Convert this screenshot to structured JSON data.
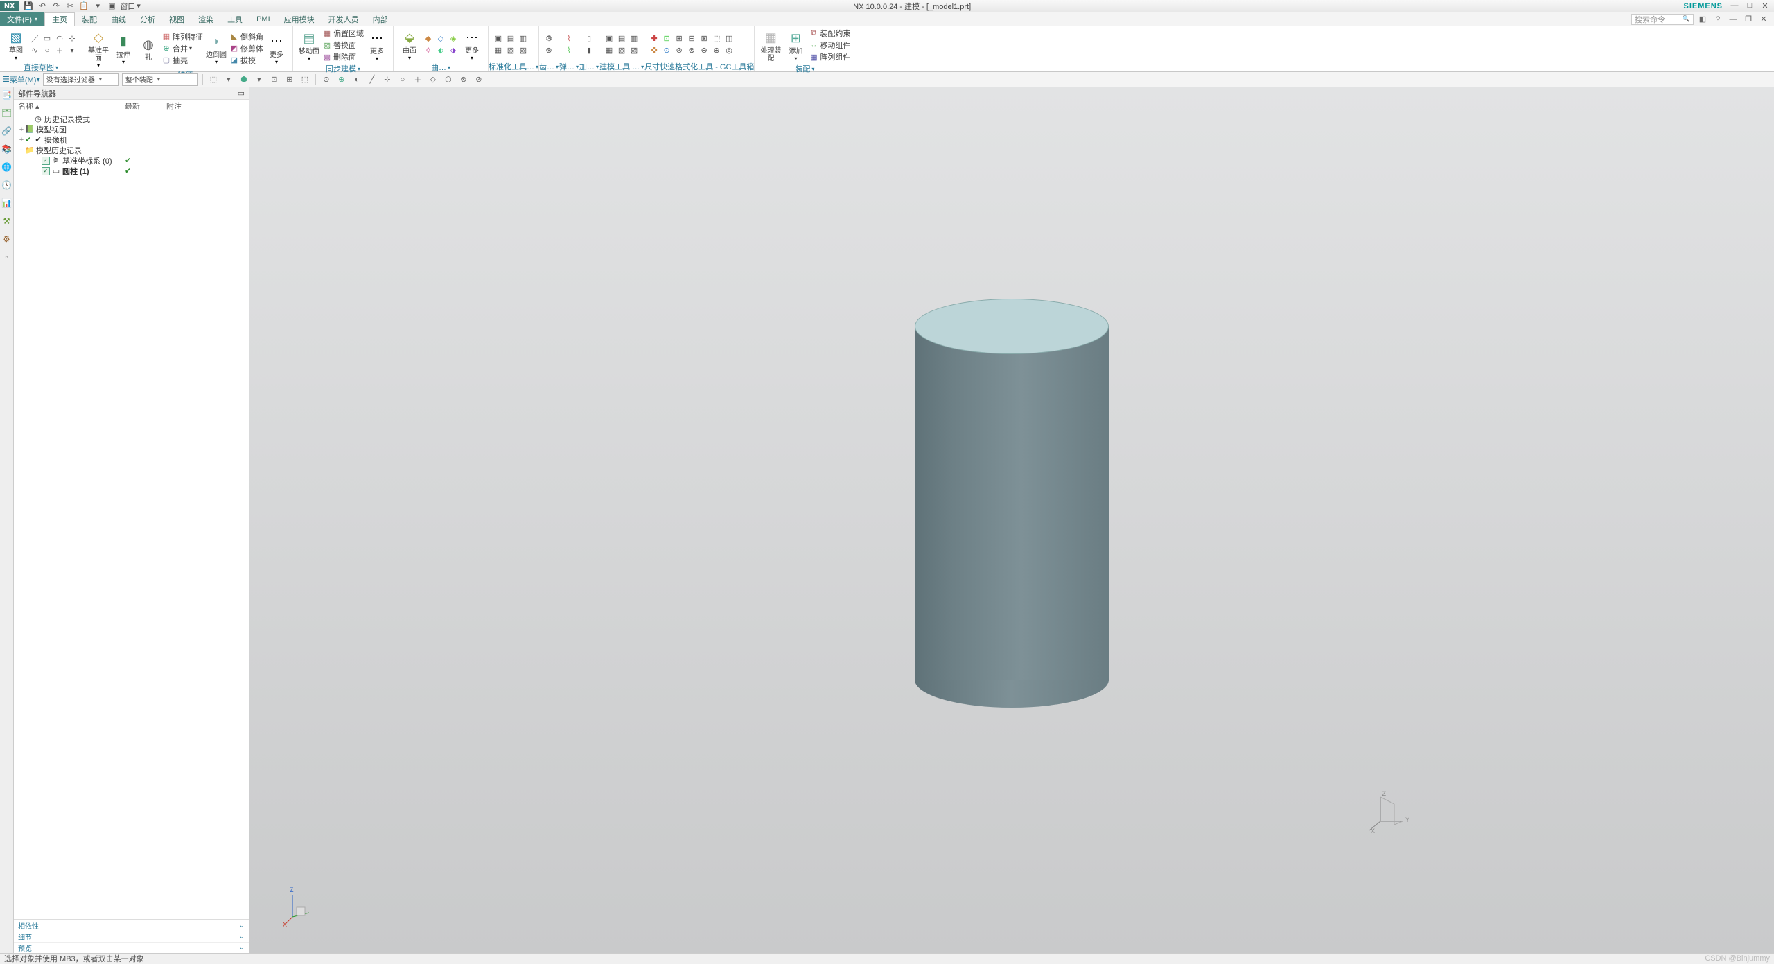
{
  "app": {
    "logo": "NX",
    "title": "NX 10.0.0.24 - 建模 - [_model1.prt]",
    "brand": "SIEMENS"
  },
  "qat": {
    "window_menu": "窗口"
  },
  "tabs": {
    "file": "文件(F)",
    "items": [
      "主页",
      "装配",
      "曲线",
      "分析",
      "视图",
      "渲染",
      "工具",
      "PMI",
      "应用模块",
      "开发人员",
      "内部"
    ],
    "active": 0
  },
  "search_placeholder": "搜索命令",
  "ribbon": {
    "g1": {
      "label": "直接草图",
      "sketch": "草图"
    },
    "g2": {
      "label": "特征",
      "datum": "基准平面",
      "extrude": "拉伸",
      "hole": "孔",
      "pattern": "阵列特征",
      "unite": "合并",
      "shell": "抽壳",
      "chamfer": "边倒圆",
      "draft": "倒斜角",
      "trim": "修剪体",
      "mold": "拔模",
      "more": "更多"
    },
    "g3": {
      "label": "同步建模",
      "moveface": "移动面",
      "offset": "偏置区域",
      "replace": "替换面",
      "delete": "删除面",
      "more": "更多"
    },
    "g4": {
      "label": "曲…",
      "surface": "曲面",
      "more": "更多"
    },
    "g5": {
      "label": "标准化工具…"
    },
    "g6": {
      "label": "齿…"
    },
    "g7": {
      "label": "弹…"
    },
    "g8": {
      "label": "加…"
    },
    "g9": {
      "label": "建模工具 …"
    },
    "g10": {
      "label": "尺寸快速格式化工具 - GC工具箱"
    },
    "g11": {
      "label": "装配",
      "process": "处理装配",
      "add": "添加",
      "constraint": "装配约束",
      "movecomp": "移动组件",
      "arraycomp": "阵列组件"
    }
  },
  "filter": {
    "menu": "菜单(M)",
    "sel_filter": "没有选择过滤器",
    "scope": "整个装配"
  },
  "navigator": {
    "title": "部件导航器",
    "cols": {
      "name": "名称",
      "latest": "最新",
      "notes": "附注"
    },
    "rows": [
      {
        "indent": 1,
        "exp": "",
        "chk": false,
        "ico": "◷",
        "txt": "历史记录模式",
        "latest": ""
      },
      {
        "indent": 0,
        "exp": "+",
        "chk": false,
        "ico": "📗",
        "txt": "模型视图",
        "latest": ""
      },
      {
        "indent": 0,
        "exp": "+",
        "chk": false,
        "ico": "✔",
        "txt": "摄像机",
        "latest": "",
        "pre": "✔"
      },
      {
        "indent": 0,
        "exp": "−",
        "chk": false,
        "ico": "📁",
        "txt": "模型历史记录",
        "latest": ""
      },
      {
        "indent": 2,
        "exp": "",
        "chk": true,
        "ico": "⚞",
        "txt": "基准坐标系 (0)",
        "latest": "✔"
      },
      {
        "indent": 2,
        "exp": "",
        "chk": true,
        "ico": "▭",
        "txt": "圆柱 (1)",
        "latest": "✔",
        "bold": true
      }
    ],
    "footers": [
      "相依性",
      "细节",
      "预览"
    ]
  },
  "status": {
    "msg": "选择对象并使用 MB3，或者双击某一对象",
    "watermark": "CSDN @Binjummy"
  }
}
